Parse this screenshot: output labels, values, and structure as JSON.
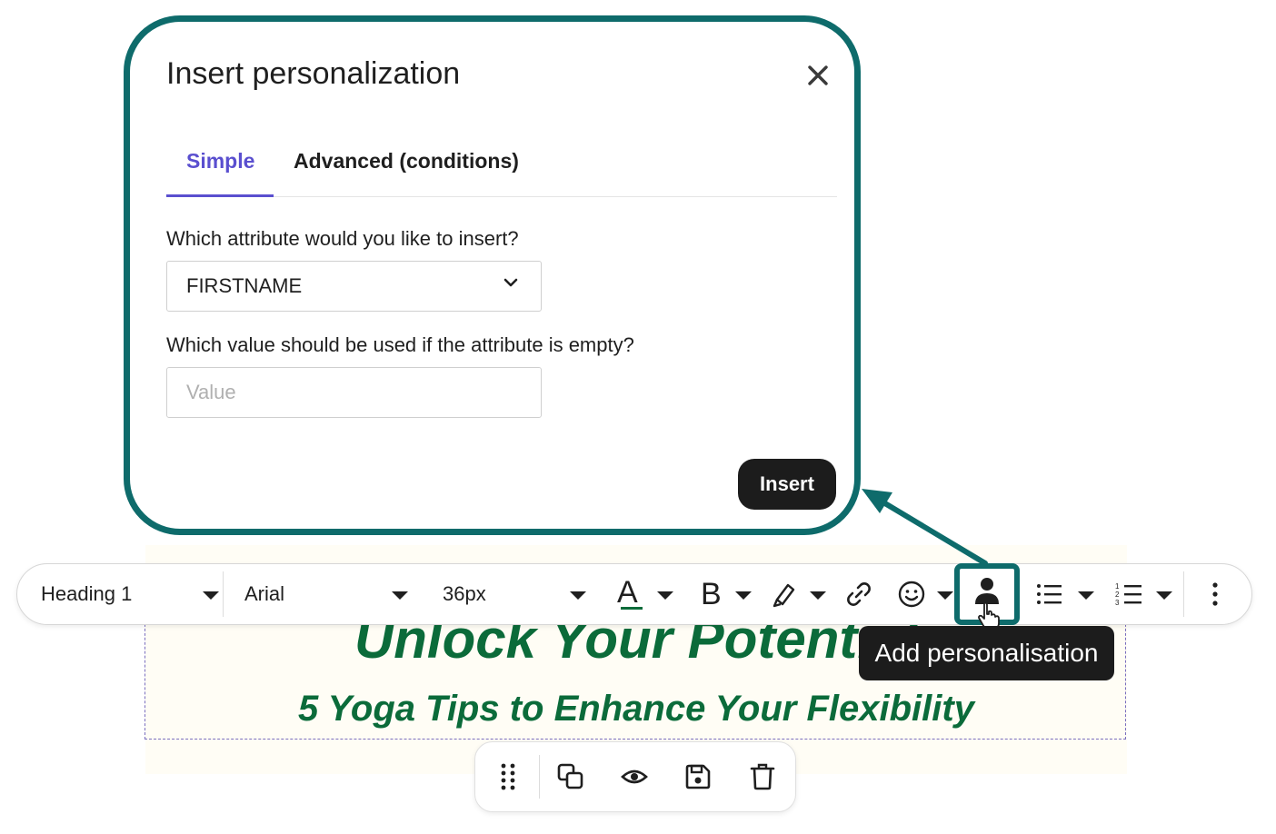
{
  "email_content": {
    "title": "Unlock Your Potential",
    "subtitle": "5 Yoga Tips to Enhance Your Flexibility"
  },
  "toolbar": {
    "block_style": "Heading 1",
    "font_family": "Arial",
    "font_size": "36px",
    "text_color_glyph": "A",
    "bold_glyph": "B",
    "tooltip": "Add personalisation",
    "buttons": [
      "text-color",
      "bold",
      "highlight",
      "link",
      "emoji",
      "personalization",
      "bulleted-list",
      "numbered-list",
      "more"
    ]
  },
  "block_actions": [
    "drag-handle",
    "duplicate",
    "preview",
    "save",
    "delete"
  ],
  "modal": {
    "title": "Insert personalization",
    "tabs": [
      {
        "label": "Simple",
        "active": true
      },
      {
        "label": "Advanced (conditions)",
        "active": false
      }
    ],
    "attribute_question": "Which attribute would you like to insert?",
    "attribute_selected": "FIRSTNAME",
    "fallback_question": "Which value should be used if the attribute is empty?",
    "fallback_placeholder": "Value",
    "fallback_value": "",
    "insert_label": "Insert"
  },
  "colors": {
    "accent_teal": "#0e6b6b",
    "tab_active": "#5a4fcf",
    "heading_green": "#0b6b3a",
    "button_dark": "#1c1c1c"
  }
}
